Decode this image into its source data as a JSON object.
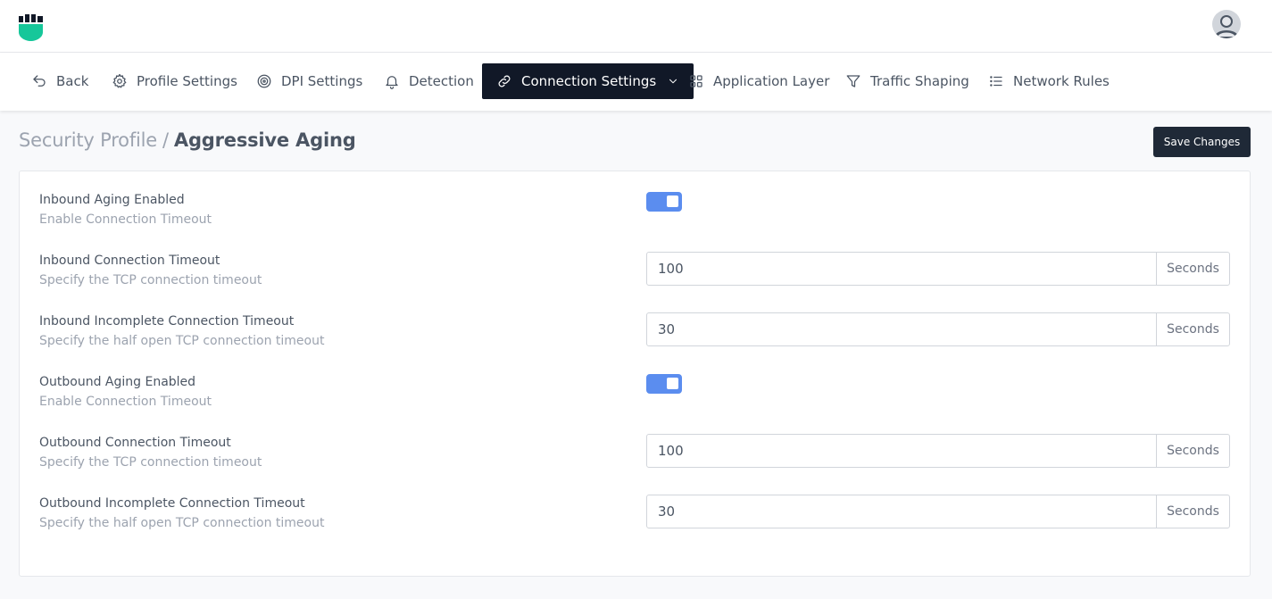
{
  "header": {
    "logo_icon": "brand-logo-icon",
    "avatar_icon": "user-avatar-icon"
  },
  "nav": {
    "items": [
      {
        "label": "Back",
        "icon": "back-arrow-icon"
      },
      {
        "label": "Profile Settings",
        "icon": "gear-icon"
      },
      {
        "label": "DPI Settings",
        "icon": "target-icon"
      },
      {
        "label": "Detection",
        "icon": "bell-icon"
      },
      {
        "label": "Connection Settings",
        "icon": "link-icon"
      },
      {
        "label": "Application Layer",
        "icon": "grid-icon"
      },
      {
        "label": "Traffic Shaping",
        "icon": "filter-icon"
      },
      {
        "label": "Network Rules",
        "icon": "list-icon"
      }
    ],
    "active": "Connection Settings"
  },
  "breadcrumb": {
    "parent": "Security Profile",
    "separator": "/",
    "current": "Aggressive Aging"
  },
  "actions": {
    "save_label": "Save Changes"
  },
  "colors": {
    "toggle_on": "#5b8def",
    "active_nav": "#111827",
    "save_button": "#1f2937"
  },
  "settings": [
    {
      "label": "Inbound Aging Enabled",
      "description": "Enable Connection Timeout",
      "type": "toggle",
      "enabled": true
    },
    {
      "label": "Inbound Connection Timeout",
      "description": "Specify the TCP connection timeout",
      "type": "number",
      "value": "100",
      "unit": "Seconds"
    },
    {
      "label": "Inbound Incomplete Connection Timeout",
      "description": "Specify the half open TCP connection timeout",
      "type": "number",
      "value": "30",
      "unit": "Seconds"
    },
    {
      "label": "Outbound Aging Enabled",
      "description": "Enable Connection Timeout",
      "type": "toggle",
      "enabled": true
    },
    {
      "label": "Outbound Connection Timeout",
      "description": "Specify the TCP connection timeout",
      "type": "number",
      "value": "100",
      "unit": "Seconds"
    },
    {
      "label": "Outbound Incomplete Connection Timeout",
      "description": "Specify the half open TCP connection timeout",
      "type": "number",
      "value": "30",
      "unit": "Seconds"
    }
  ]
}
